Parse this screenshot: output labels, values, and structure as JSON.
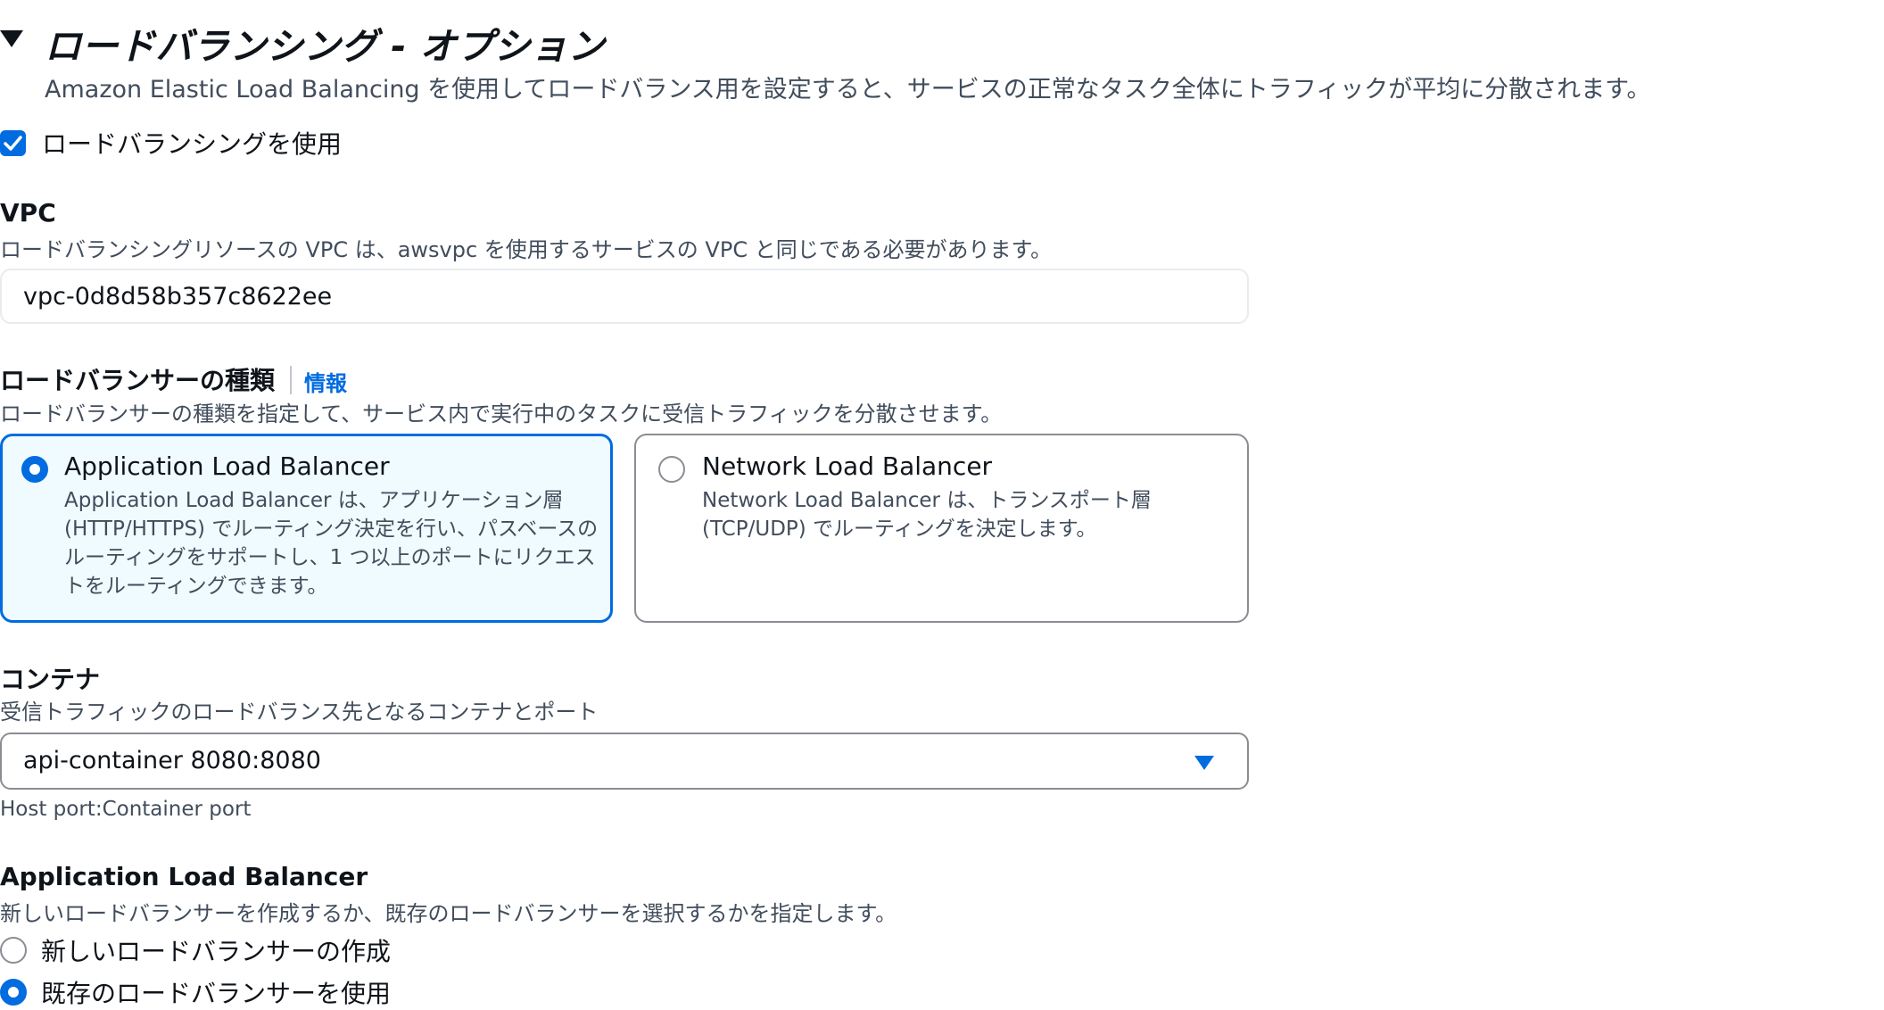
{
  "section": {
    "title": "ロードバランシング - オプション",
    "description": "Amazon Elastic Load Balancing を使用してロードバランス用を設定すると、サービスの正常なタスク全体にトラフィックが平均に分散されます。",
    "expanded_icon": "caret-down-icon"
  },
  "use_load_balancing": {
    "label": "ロードバランシングを使用",
    "checked": true
  },
  "vpc": {
    "label": "VPC",
    "description": "ロードバランシングリソースの VPC は、awsvpc を使用するサービスの VPC と同じである必要があります。",
    "value": "vpc-0d8d58b357c8622ee"
  },
  "lb_type": {
    "label": "ロードバランサーの種類",
    "info_link": "情報",
    "description": "ロードバランサーの種類を指定して、サービス内で実行中のタスクに受信トラフィックを分散させます。",
    "options": [
      {
        "title": "Application Load Balancer",
        "description": "Application Load Balancer は、アプリケーション層 (HTTP/HTTPS) でルーティング決定を行い、パスベースのルーティングをサポートし、1 つ以上のポートにリクエストをルーティングできます。",
        "selected": true
      },
      {
        "title": "Network Load Balancer",
        "description": "Network Load Balancer は、トランスポート層 (TCP/UDP) でルーティングを決定します。",
        "selected": false
      }
    ]
  },
  "container": {
    "label": "コンテナ",
    "description": "受信トラフィックのロードバランス先となるコンテナとポート",
    "value": "api-container 8080:8080",
    "constraint": "Host port:Container port"
  },
  "alb": {
    "label": "Application Load Balancer",
    "description": "新しいロードバランサーを作成するか、既存のロードバランサーを選択するかを指定します。",
    "options": [
      {
        "label": "新しいロードバランサーの作成",
        "selected": false
      },
      {
        "label": "既存のロードバランサーを使用",
        "selected": true
      }
    ]
  },
  "colors": {
    "accent": "#006ce0",
    "selected_tile_bg": "#f0fbff",
    "text": "#0f141a",
    "secondary_text": "#414d5c"
  }
}
